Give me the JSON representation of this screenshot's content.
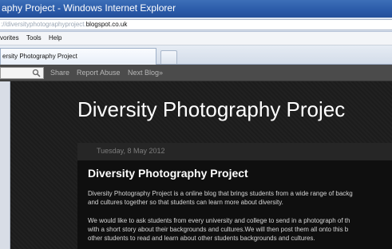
{
  "window": {
    "title": "aphy Project - Windows Internet Explorer"
  },
  "address": {
    "prefix": "://diversityphotographyproject.",
    "domain": "blogspot.co.uk"
  },
  "menu": {
    "items": [
      "vorites",
      "Tools",
      "Help"
    ]
  },
  "tabs": {
    "active_label": "ersity Photography Project"
  },
  "blogger_bar": {
    "share_label": "Share",
    "report_label": "Report Abuse",
    "next_label": "Next Blog»"
  },
  "blog": {
    "title": "Diversity Photography Projec"
  },
  "post": {
    "date": "Tuesday, 8 May 2012",
    "title": "Diversity Photography Project",
    "paragraph1_line1": "Diversity Photography Project is a online blog that brings students from a wide range of backg",
    "paragraph1_line2": "and cultures together so that students can learn more about diversity.",
    "paragraph2_line1": "We would like to ask students from every university and college to send in a photograph of th",
    "paragraph2_line2": "with a short story about their backgrounds and cultures.We will then post them all onto this b",
    "paragraph2_line3": "other students to read and learn about other students backgrounds and cultures."
  },
  "colors": {
    "titlebar": "#2a5aa8",
    "page_background": "#1c1c1c",
    "post_panel": "#0f0f0f",
    "blog_title_text": "#ffffff"
  },
  "icons": {
    "search": "search-icon"
  }
}
